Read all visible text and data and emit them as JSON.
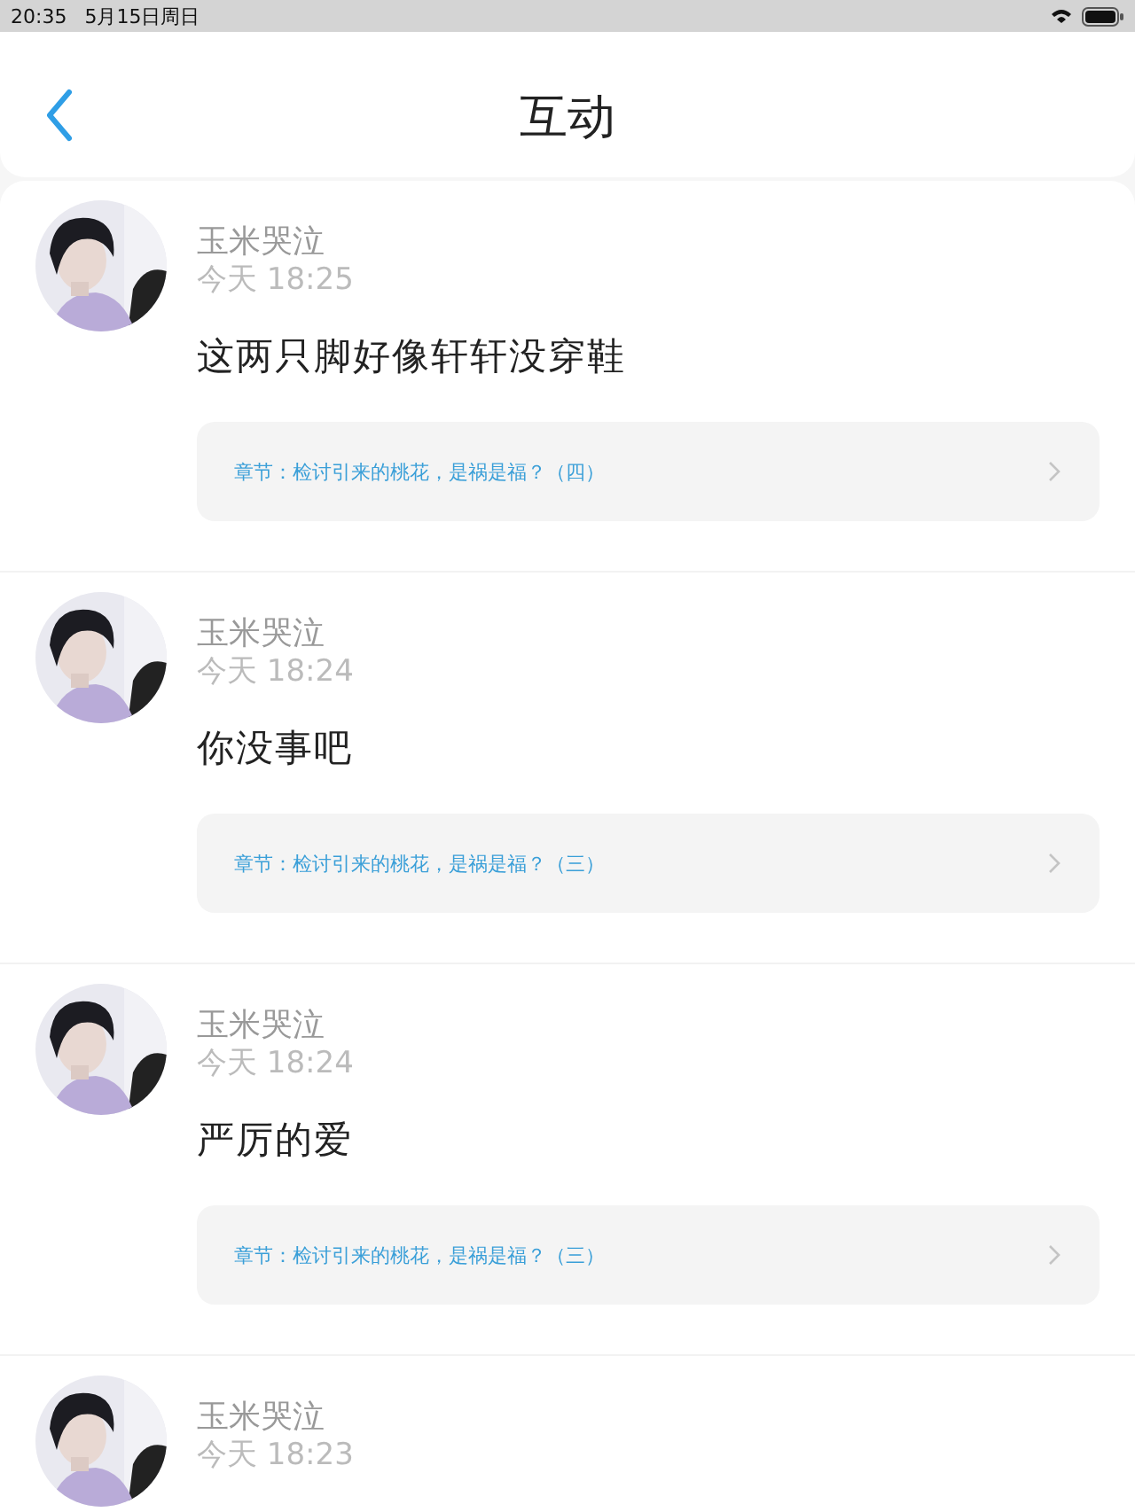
{
  "status_bar": {
    "time": "20:35",
    "date": "5月15日周日"
  },
  "header": {
    "title": "互动"
  },
  "posts": [
    {
      "author": "玉米哭泣",
      "time": "今天 18:25",
      "text": "这两只脚好像轩轩没穿鞋",
      "chapter": "章节：检讨引来的桃花，是祸是福？（四）"
    },
    {
      "author": "玉米哭泣",
      "time": "今天 18:24",
      "text": "你没事吧",
      "chapter": "章节：检讨引来的桃花，是祸是福？（三）"
    },
    {
      "author": "玉米哭泣",
      "time": "今天 18:24",
      "text": "严厉的爱",
      "chapter": "章节：检讨引来的桃花，是祸是福？（三）"
    },
    {
      "author": "玉米哭泣",
      "time": "今天 18:23"
    }
  ]
}
